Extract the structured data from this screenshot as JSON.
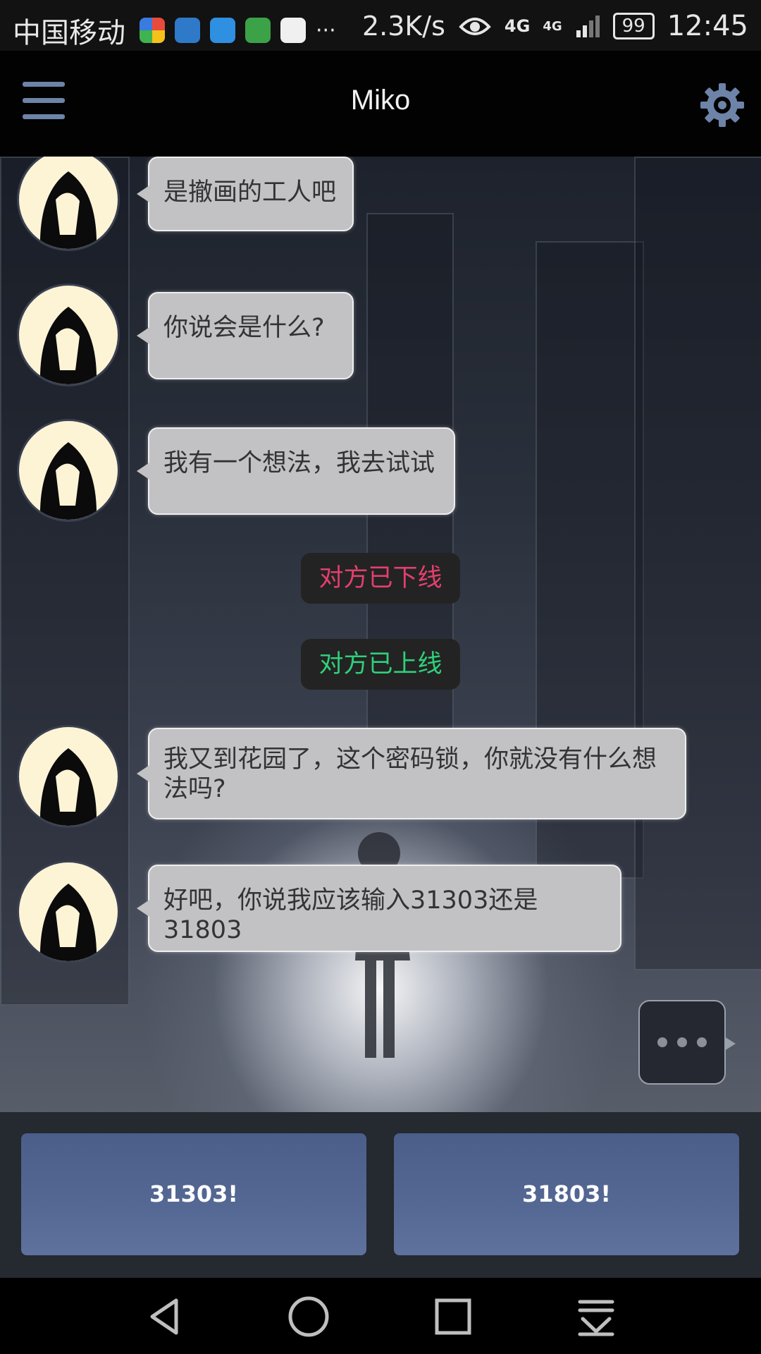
{
  "status_bar": {
    "carrier": "中国移动",
    "overflow": "···",
    "net_speed": "2.3K/s",
    "network_1": "4G",
    "network_2": "4G",
    "battery": "99",
    "time": "12:45",
    "app_icons": [
      "browser-icon",
      "health-icon",
      "messages-icon",
      "wechat-icon",
      "gallery-icon"
    ]
  },
  "app_bar": {
    "title": "Miko",
    "menu_icon": "menu-icon",
    "settings_icon": "gear-icon"
  },
  "messages": [
    {
      "type": "incoming",
      "text": "是撤画的工人吧"
    },
    {
      "type": "incoming",
      "text": "你说会是什么?"
    },
    {
      "type": "incoming",
      "text": "我有一个想法，我去试试"
    },
    {
      "type": "system",
      "text": "对方已下线",
      "color": "#e2406e"
    },
    {
      "type": "system",
      "text": "对方已上线",
      "color": "#2fd07a"
    },
    {
      "type": "incoming",
      "text": "我又到花园了，这个密码锁，你就没有什么想法吗?"
    },
    {
      "type": "incoming",
      "text": "好吧，你说我应该输入31303还是31803"
    }
  ],
  "typing_indicator": "···",
  "choices": [
    "31303!",
    "31803!"
  ],
  "nav_bar": [
    "back-icon",
    "home-icon",
    "recents-icon",
    "notification-pull-icon"
  ],
  "colors": {
    "accent": "#6d83a8",
    "choice_button": "#556894",
    "bubble": "#c2c2c4",
    "offline": "#e2406e",
    "online": "#2fd07a"
  }
}
